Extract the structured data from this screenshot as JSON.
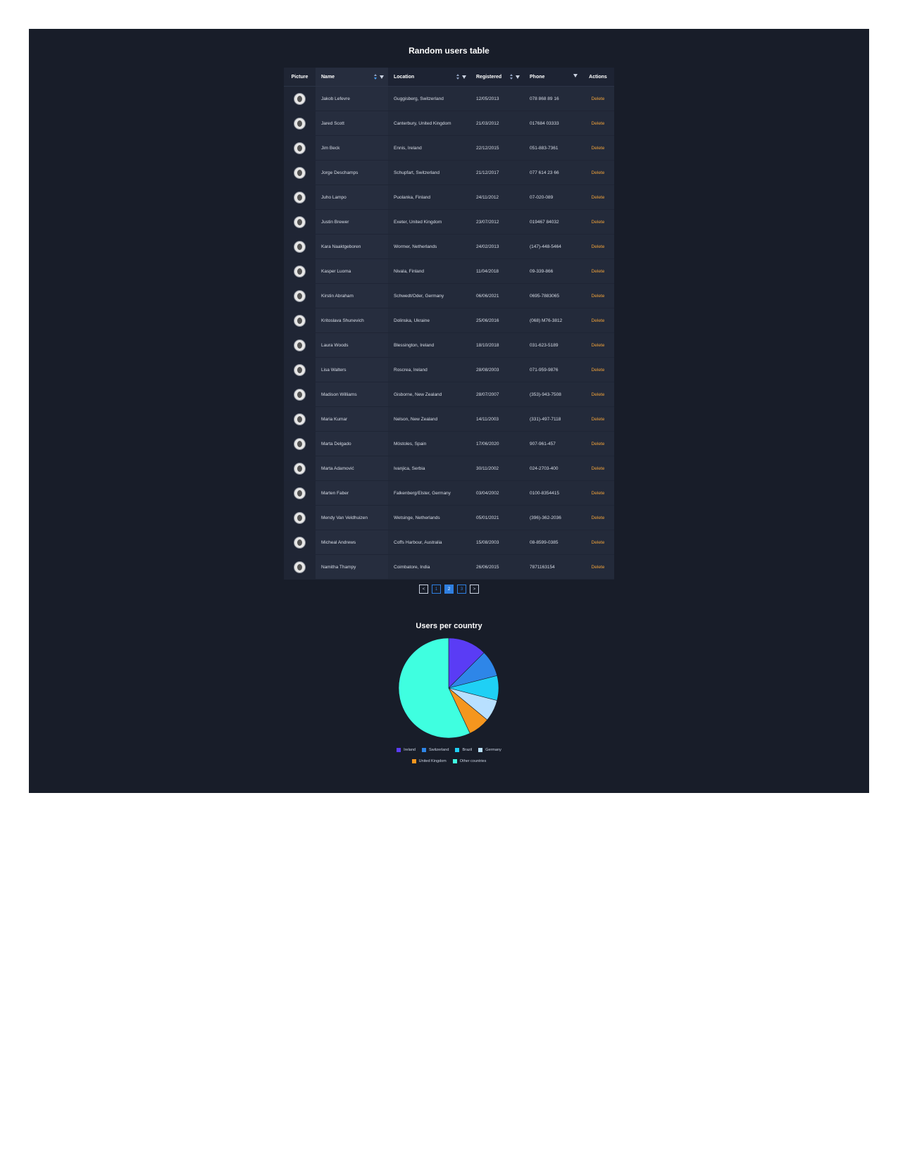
{
  "page_title": "Random users table",
  "table": {
    "columns": {
      "picture": "Picture",
      "name": "Name",
      "location": "Location",
      "registered": "Registered",
      "phone": "Phone",
      "actions": "Actions"
    },
    "rows": [
      {
        "name": "Jakob Lefevre",
        "location": "Guggisberg, Switzerland",
        "registered": "12/05/2013",
        "phone": "078 868 89 16",
        "action": "Delete"
      },
      {
        "name": "Jared Scott",
        "location": "Canterbury, United Kingdom",
        "registered": "21/03/2012",
        "phone": "017684 03333",
        "action": "Delete"
      },
      {
        "name": "Jim Beck",
        "location": "Ennis, Ireland",
        "registered": "22/12/2015",
        "phone": "051-883-7361",
        "action": "Delete"
      },
      {
        "name": "Jorge Deschamps",
        "location": "Schupfart, Switzerland",
        "registered": "21/12/2017",
        "phone": "077 614 23 66",
        "action": "Delete"
      },
      {
        "name": "Juho Lampo",
        "location": "Puolanka, Finland",
        "registered": "24/11/2012",
        "phone": "07-020-089",
        "action": "Delete"
      },
      {
        "name": "Justin Brewer",
        "location": "Exeter, United Kingdom",
        "registered": "23/07/2012",
        "phone": "019467 84032",
        "action": "Delete"
      },
      {
        "name": "Kara Naaktgeboren",
        "location": "Wormer, Netherlands",
        "registered": "24/02/2013",
        "phone": "(147)-448-5464",
        "action": "Delete"
      },
      {
        "name": "Kasper Luoma",
        "location": "Nivala, Finland",
        "registered": "11/04/2018",
        "phone": "09-339-866",
        "action": "Delete"
      },
      {
        "name": "Kirstin Abraham",
        "location": "Schwedt/Oder, Germany",
        "registered": "06/06/2021",
        "phone": "0695-7883065",
        "action": "Delete"
      },
      {
        "name": "Kritoslava Shunevich",
        "location": "Dolinska, Ukraine",
        "registered": "25/06/2016",
        "phone": "(068) M76-3812",
        "action": "Delete"
      },
      {
        "name": "Laura Woods",
        "location": "Blessington, Ireland",
        "registered": "18/10/2018",
        "phone": "031-623-5189",
        "action": "Delete"
      },
      {
        "name": "Lisa Walters",
        "location": "Roscrea, Ireland",
        "registered": "28/08/2003",
        "phone": "071-959-9876",
        "action": "Delete"
      },
      {
        "name": "Madison Williams",
        "location": "Gisborne, New Zealand",
        "registered": "28/07/2007",
        "phone": "(353)-943-7508",
        "action": "Delete"
      },
      {
        "name": "Maria Kumar",
        "location": "Nelson, New Zealand",
        "registered": "14/11/2003",
        "phone": "(331)-497-7118",
        "action": "Delete"
      },
      {
        "name": "Marta Delgado",
        "location": "Móstoles, Spain",
        "registered": "17/06/2020",
        "phone": "907-961-457",
        "action": "Delete"
      },
      {
        "name": "Marta Adamović",
        "location": "Ivanjica, Serbia",
        "registered": "30/11/2002",
        "phone": "024-2703-400",
        "action": "Delete"
      },
      {
        "name": "Marten Faber",
        "location": "Falkenberg/Elster, Germany",
        "registered": "03/04/2002",
        "phone": "0100-8354415",
        "action": "Delete"
      },
      {
        "name": "Mendy Van Veldhuizen",
        "location": "Wetsinge, Netherlands",
        "registered": "05/01/2021",
        "phone": "(396)-362-2036",
        "action": "Delete"
      },
      {
        "name": "Micheal Andrews",
        "location": "Coffs Harbour, Australia",
        "registered": "15/08/2003",
        "phone": "08-8599-0385",
        "action": "Delete"
      },
      {
        "name": "Namitha Thampy",
        "location": "Coimbatore, India",
        "registered": "26/06/2015",
        "phone": "7871163154",
        "action": "Delete"
      }
    ]
  },
  "pagination": {
    "prev": "<",
    "next": ">",
    "pages": [
      "1",
      "2",
      "3"
    ],
    "current": "2"
  },
  "chart_data": {
    "type": "pie",
    "title": "Users per country",
    "legend_placement": "bottom",
    "slices": [
      {
        "label": "Ireland",
        "value": 12.5,
        "color": "#5a3cf5"
      },
      {
        "label": "Switzerland",
        "value": 8.5,
        "color": "#2e86e8"
      },
      {
        "label": "Brazil",
        "value": 8,
        "color": "#1fd0f5"
      },
      {
        "label": "Germany",
        "value": 7,
        "color": "#b8e0ff"
      },
      {
        "label": "United Kingdom",
        "value": 7,
        "color": "#f5961e"
      },
      {
        "label": "Other countries",
        "value": 57,
        "color": "#3fffe0"
      }
    ]
  }
}
